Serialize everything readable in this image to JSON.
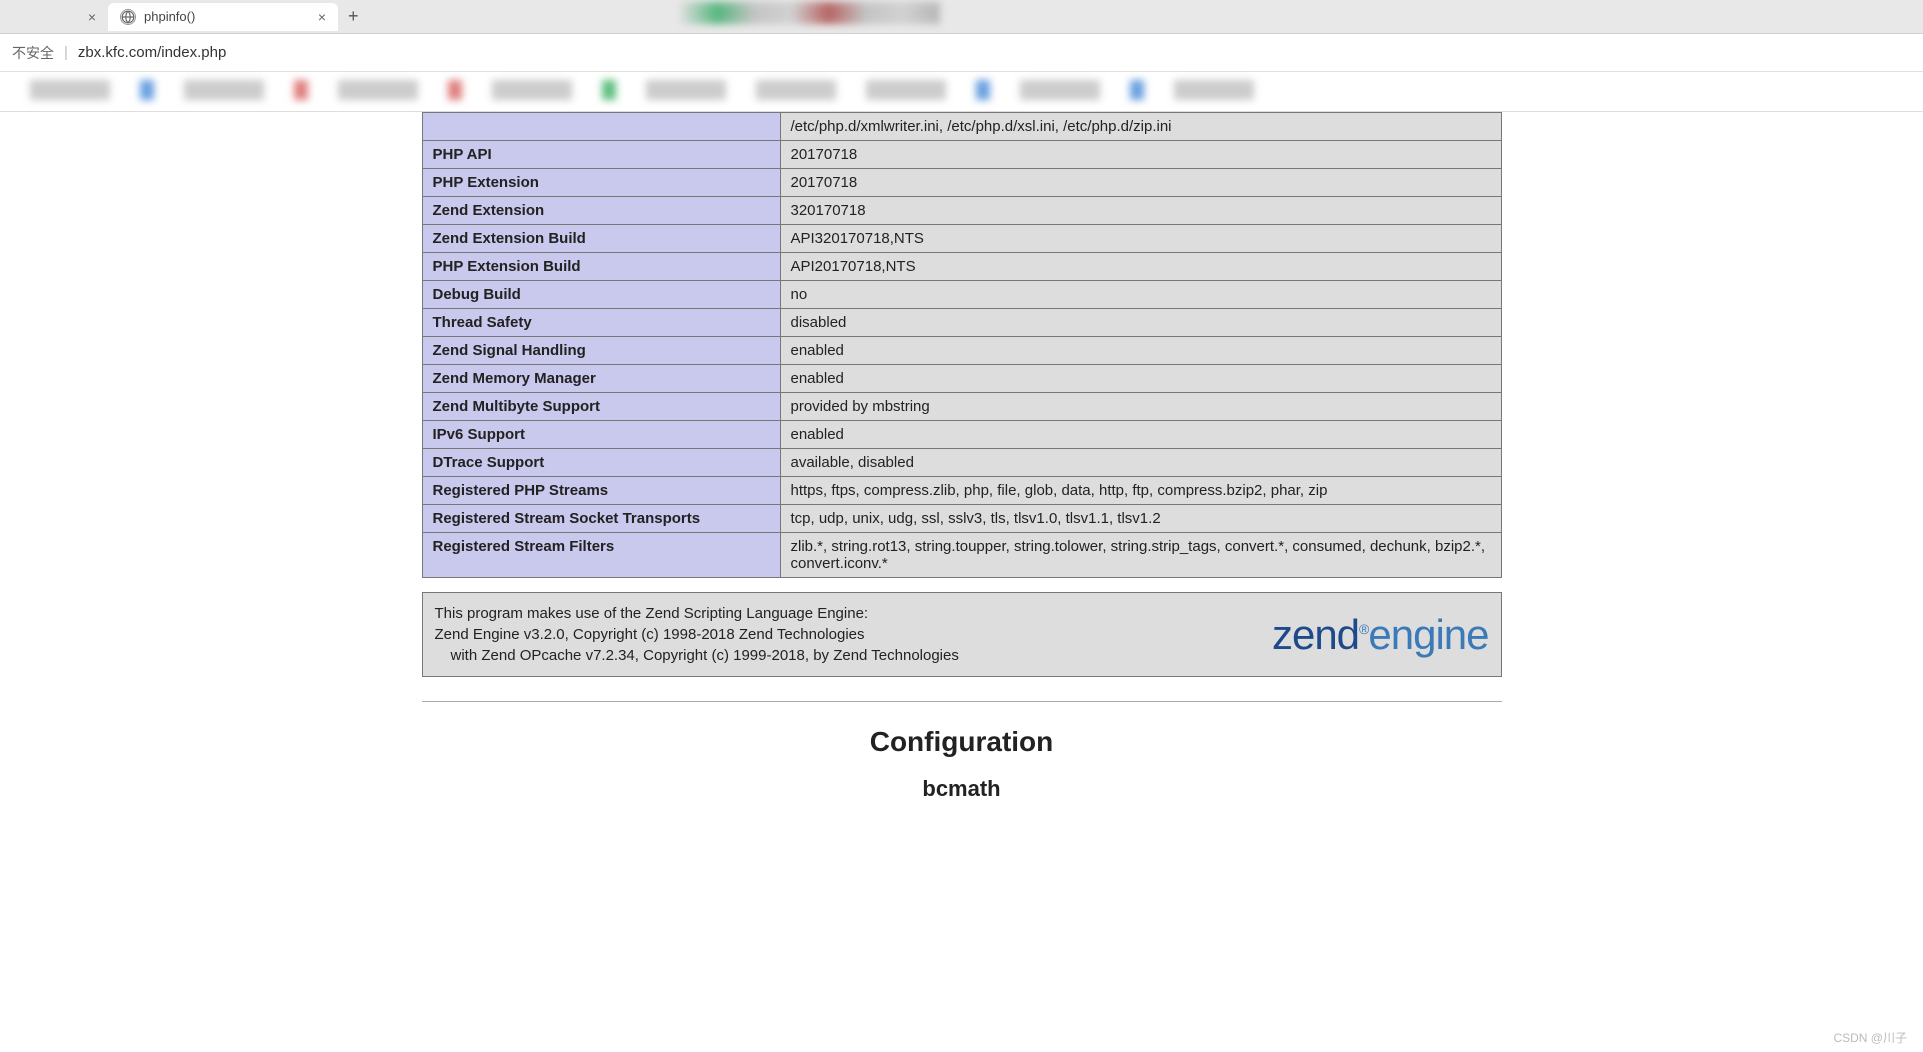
{
  "browser": {
    "inactive_tab_close": "×",
    "active_tab_title": "phpinfo()",
    "active_tab_close": "×",
    "new_tab": "+",
    "security_label": "不安全",
    "url": "zbx.kfc.com/index.php"
  },
  "truncated_top_value": "/etc/php.d/xmlwriter.ini, /etc/php.d/xsl.ini, /etc/php.d/zip.ini",
  "rows": [
    {
      "label": "PHP API",
      "value": "20170718"
    },
    {
      "label": "PHP Extension",
      "value": "20170718"
    },
    {
      "label": "Zend Extension",
      "value": "320170718"
    },
    {
      "label": "Zend Extension Build",
      "value": "API320170718,NTS"
    },
    {
      "label": "PHP Extension Build",
      "value": "API20170718,NTS"
    },
    {
      "label": "Debug Build",
      "value": "no"
    },
    {
      "label": "Thread Safety",
      "value": "disabled"
    },
    {
      "label": "Zend Signal Handling",
      "value": "enabled"
    },
    {
      "label": "Zend Memory Manager",
      "value": "enabled"
    },
    {
      "label": "Zend Multibyte Support",
      "value": "provided by mbstring"
    },
    {
      "label": "IPv6 Support",
      "value": "enabled"
    },
    {
      "label": "DTrace Support",
      "value": "available, disabled"
    },
    {
      "label": "Registered PHP Streams",
      "value": "https, ftps, compress.zlib, php, file, glob, data, http, ftp, compress.bzip2, phar, zip"
    },
    {
      "label": "Registered Stream Socket Transports",
      "value": "tcp, udp, unix, udg, ssl, sslv3, tls, tlsv1.0, tlsv1.1, tlsv1.2"
    },
    {
      "label": "Registered Stream Filters",
      "value": "zlib.*, string.rot13, string.toupper, string.tolower, string.strip_tags, convert.*, consumed, dechunk, bzip2.*, convert.iconv.*"
    }
  ],
  "zend": {
    "line1": "This program makes use of the Zend Scripting Language Engine:",
    "line2": "Zend Engine v3.2.0, Copyright (c) 1998-2018 Zend Technologies",
    "line3": "with Zend OPcache v7.2.34, Copyright (c) 1999-2018, by Zend Technologies",
    "logo_zend": "zend",
    "logo_engine": "engine",
    "logo_reg": "®"
  },
  "headings": {
    "configuration": "Configuration",
    "bcmath": "bcmath"
  },
  "watermark": "CSDN @川子"
}
